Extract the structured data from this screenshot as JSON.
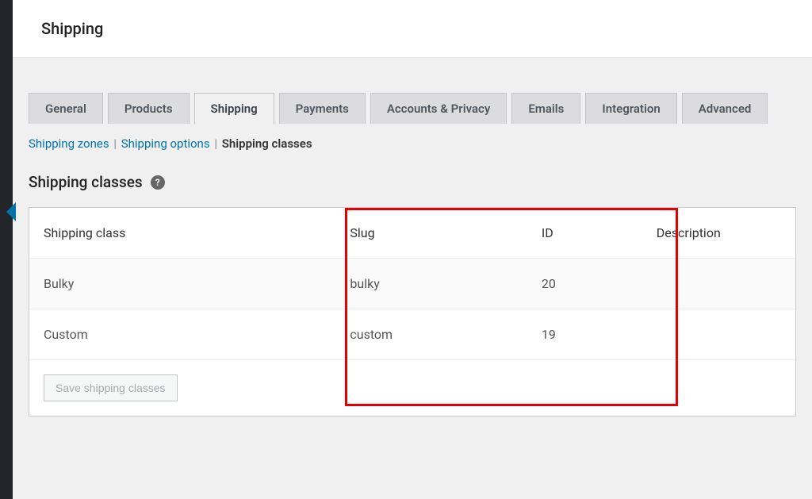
{
  "page": {
    "title": "Shipping"
  },
  "tabs": {
    "general": "General",
    "products": "Products",
    "shipping": "Shipping",
    "payments": "Payments",
    "accounts": "Accounts & Privacy",
    "emails": "Emails",
    "integration": "Integration",
    "advanced": "Advanced"
  },
  "subtabs": {
    "zones": "Shipping zones",
    "options": "Shipping options",
    "classes": "Shipping classes"
  },
  "section": {
    "heading": "Shipping classes",
    "help_glyph": "?"
  },
  "table": {
    "headers": {
      "class": "Shipping class",
      "slug": "Slug",
      "id": "ID",
      "description": "Description"
    },
    "rows": [
      {
        "class": "Bulky",
        "slug": "bulky",
        "id": "20",
        "description": ""
      },
      {
        "class": "Custom",
        "slug": "custom",
        "id": "19",
        "description": ""
      }
    ]
  },
  "buttons": {
    "save": "Save shipping classes"
  }
}
